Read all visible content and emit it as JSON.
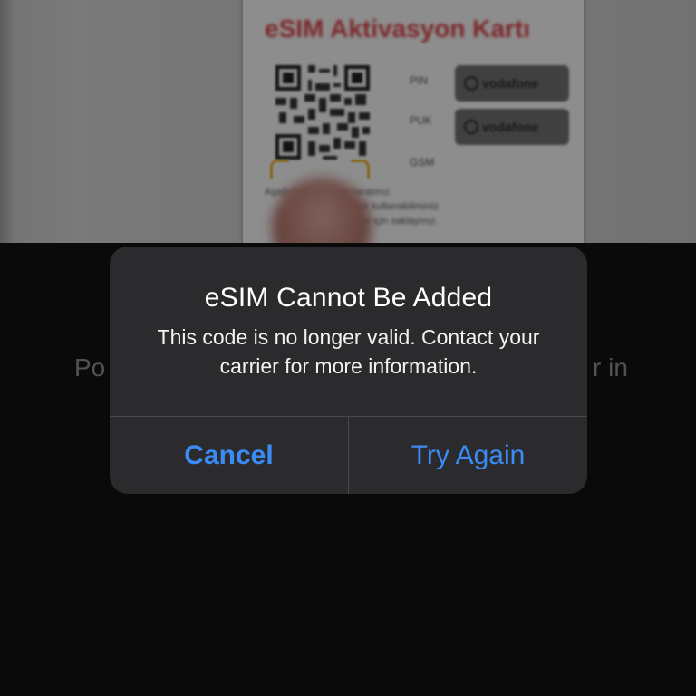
{
  "camera_view": {
    "card_title": "eSIM Aktivasyon Kartı",
    "fields": [
      {
        "label": "PIN",
        "brand": "vodafone"
      },
      {
        "label": "PUK",
        "brand": "vodafone"
      },
      {
        "label": "GSM",
        "brand": ""
      }
    ],
    "instruction_lines": [
      "Aşağıdaki QR kodu taratınız.",
      "Kazıyarak kullanabilirsiniz.",
      "…tanımlar için saklayınız."
    ]
  },
  "background": {
    "instruction_left": "Po",
    "instruction_right": "r in"
  },
  "alert": {
    "title": "eSIM Cannot Be Added",
    "message": "This code is no longer valid. Contact your carrier for more information.",
    "cancel_label": "Cancel",
    "try_again_label": "Try Again"
  },
  "colors": {
    "alert_background": "#2b2b2d",
    "button_text": "#3b8bf5",
    "card_title": "#d8454a",
    "scan_frame": "#e6b63b"
  }
}
